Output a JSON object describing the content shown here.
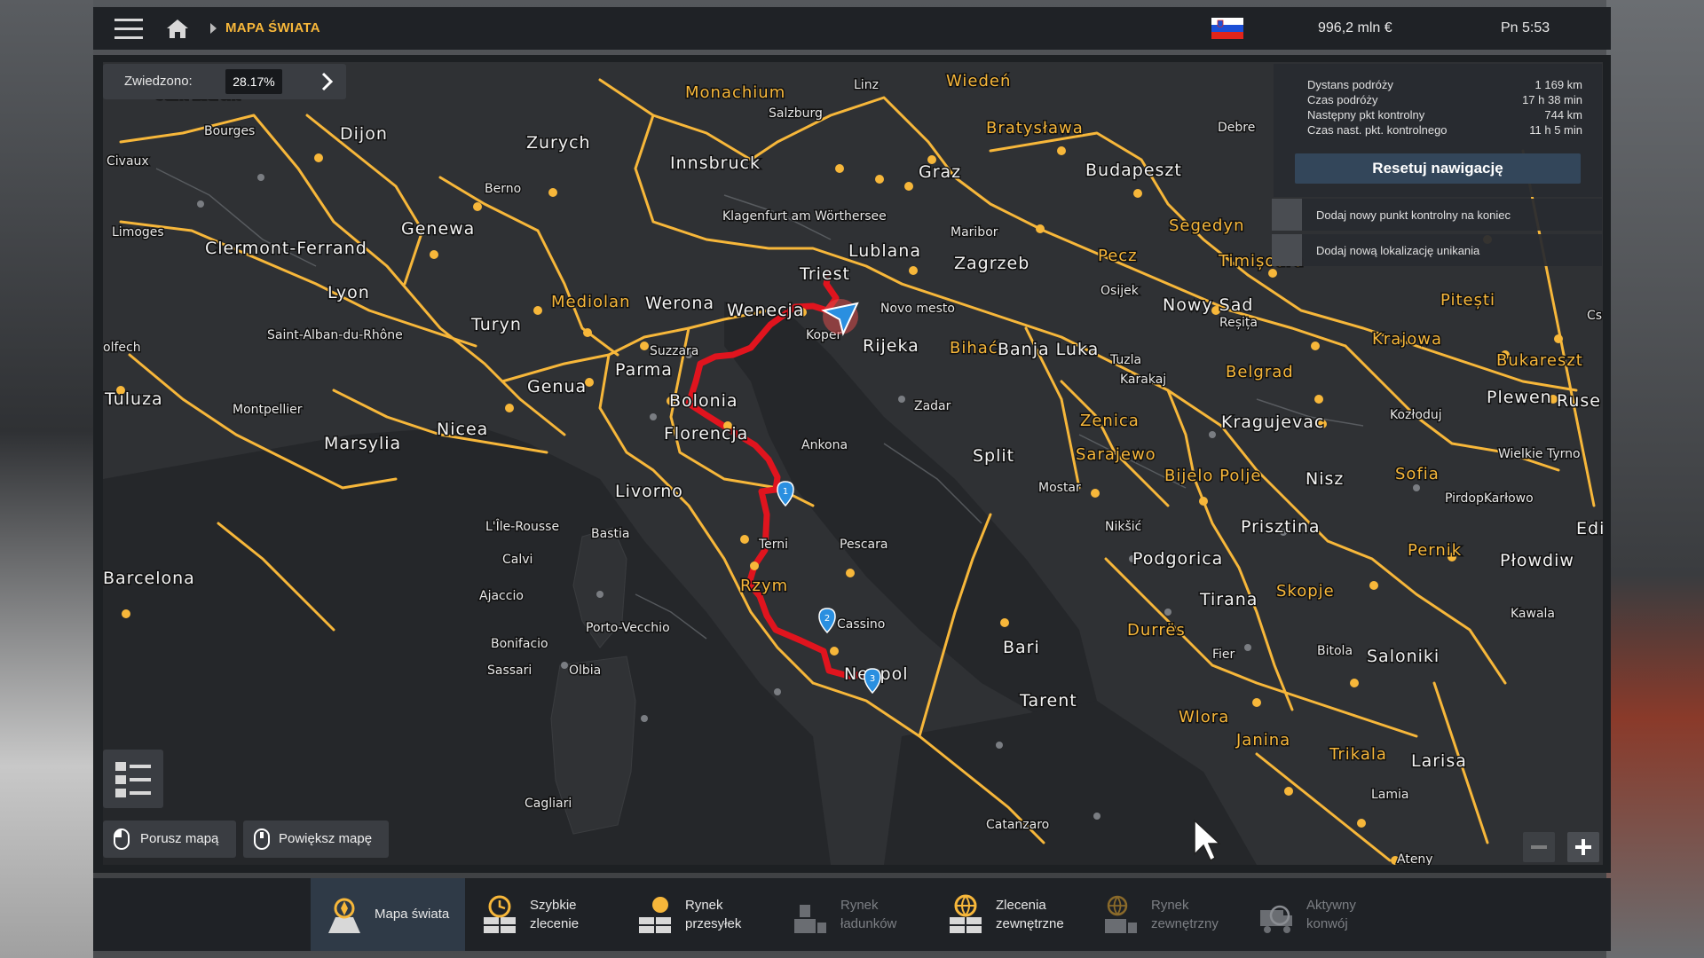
{
  "topbar": {
    "breadcrumb": "MAPA ŚWIATA",
    "money": "996,2 mln €",
    "time": "Pn 5:53",
    "flag_colors": [
      "#ffffff",
      "#1c4fd6",
      "#e1251b"
    ]
  },
  "visited": {
    "label": "Zwiedzono:",
    "value": "28.17%"
  },
  "navigation": {
    "rows": [
      {
        "label": "Dystans podróży",
        "value": "1 169 km"
      },
      {
        "label": "Czas podróży",
        "value": "17 h 38 min"
      },
      {
        "label": "Następny pkt kontrolny",
        "value": "744 km"
      },
      {
        "label": "Czas nast. pkt. kontrolnego",
        "value": "11 h 5 min"
      }
    ],
    "reset_label": "Resetuj nawigację",
    "options": [
      "Dodaj nowy punkt kontrolny na koniec",
      "Dodaj nową lokalizację unikania"
    ]
  },
  "hints": {
    "move": "Porusz mapą",
    "zoom": "Powiększ mapę"
  },
  "tabs": [
    {
      "line1": "Mapa świata",
      "line2": "",
      "active": true,
      "dim": false
    },
    {
      "line1": "Szybkie",
      "line2": "zlecenie",
      "active": false,
      "dim": false
    },
    {
      "line1": "Rynek",
      "line2": "przesyłek",
      "active": false,
      "dim": false
    },
    {
      "line1": "Rynek",
      "line2": "ładunków",
      "active": false,
      "dim": true
    },
    {
      "line1": "Zlecenia",
      "line2": "zewnętrzne",
      "active": false,
      "dim": false
    },
    {
      "line1": "Rynek",
      "line2": "zewnętrzny",
      "active": false,
      "dim": true
    },
    {
      "line1": "Aktywny",
      "line2": "konwój",
      "active": false,
      "dim": true
    }
  ],
  "map": {
    "cities": [
      "Saint-Laurent",
      "Bourges",
      "Civaux",
      "Limoges",
      "Dijon",
      "Zurych",
      "Berno",
      "Genewa",
      "Clermont-Ferrand",
      "Lyon",
      "Saint-Alban-du-Rhône",
      "Turyn",
      "Mediolan",
      "Werona",
      "Wenecja",
      "Suzzara",
      "Parma",
      "Genua",
      "Bolonia",
      "Florencja",
      "Livorno",
      "Ankona",
      "Nicea",
      "Marsylia",
      "Montpellier",
      "Tuluza",
      "olfech",
      "Barcelona",
      "L'Île-Rousse",
      "Bastia",
      "Calvi",
      "Ajaccio",
      "Porto-Vecchio",
      "Bonifacio",
      "Sassari",
      "Olbia",
      "Cagliari",
      "Terni",
      "Rzym",
      "Pescara",
      "Cassino",
      "Neapol",
      "Bari",
      "Tarent",
      "Catanzaro",
      "Monachium",
      "Salzburg",
      "Linz",
      "Wiedeń",
      "Innsbruck",
      "Klagenfurt am Wörthersee",
      "Graz",
      "Bratysława",
      "Triest",
      "Lublana",
      "Koper",
      "Novo mesto",
      "Rijeka",
      "Maribor",
      "Zagrzeb",
      "Budapeszt",
      "Debre",
      "Segedyn",
      "Pecz",
      "Osijek",
      "Nowy Sad",
      "Timișoara",
      "Reșița",
      "Pitești",
      "Krajowa",
      "Bukareszt",
      "Bihać",
      "Banja Luka",
      "Tuzla",
      "Karakaj",
      "Belgrad",
      "Zadar",
      "Split",
      "Zenica",
      "Sarajewo",
      "Kragujevac",
      "Kozłoduj",
      "Plewen",
      "Ruse",
      "Wielkie Tyrno",
      "Mostar",
      "Bijelo Polje",
      "Nisz",
      "Sofia",
      "PirdopKarłowo",
      "Nikšić",
      "Podgorica",
      "Prisztina",
      "Pernik",
      "Płowdiw",
      "Edi",
      "Tirana",
      "Skopje",
      "Kawala",
      "Durrës",
      "Fier",
      "Bitola",
      "Saloniki",
      "Wlora",
      "Janina",
      "Trikala",
      "Larisa",
      "Lamia",
      "Ateny",
      "Cs"
    ],
    "route_waypoints": [
      "1",
      "2",
      "3"
    ],
    "road_color": "#f7b73a",
    "route_color": "#e0141e"
  }
}
